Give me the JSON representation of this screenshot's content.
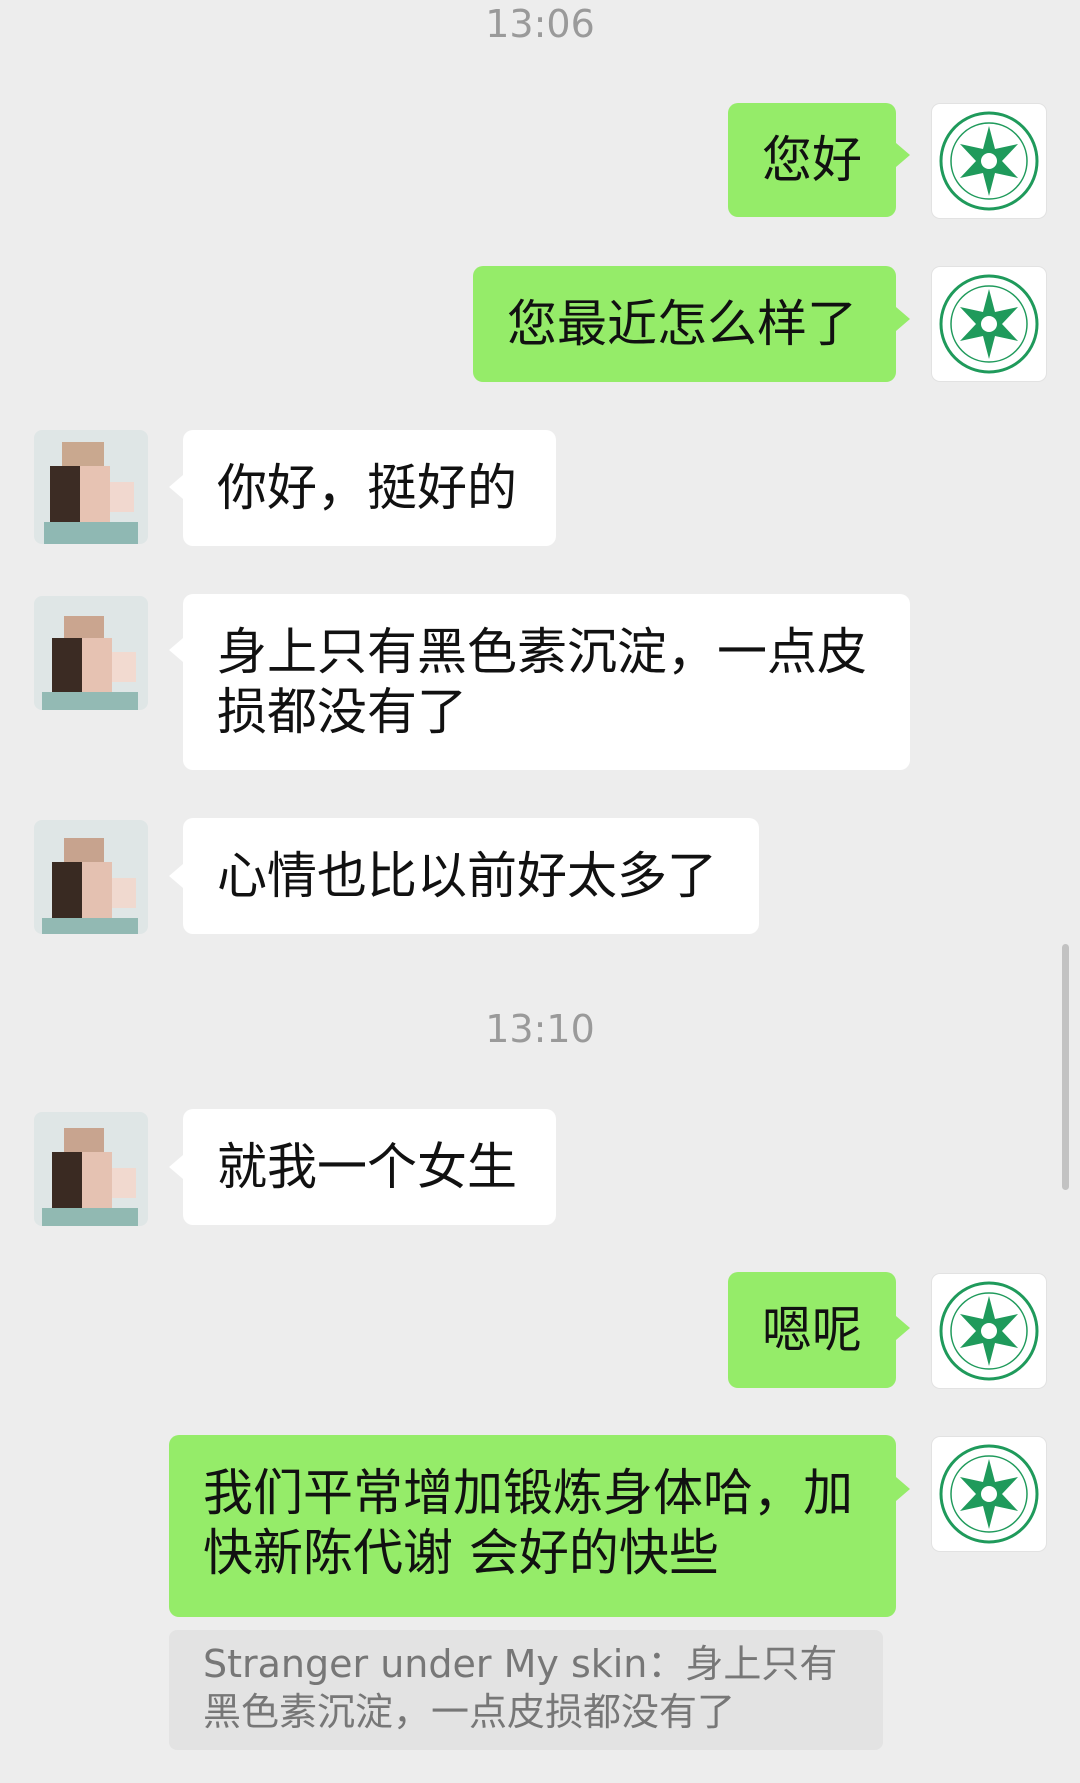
{
  "timestamps": [
    "13:06",
    "13:10"
  ],
  "messages": [
    {
      "side": "out",
      "text": "您好"
    },
    {
      "side": "out",
      "text": "您最近怎么样了"
    },
    {
      "side": "in",
      "text": "你好，挺好的"
    },
    {
      "side": "in",
      "text": "身上只有黑色素沉淀，一点皮\n损都没有了"
    },
    {
      "side": "in",
      "text": "心情也比以前好太多了"
    },
    {
      "side": "in",
      "text": "就我一个女生"
    },
    {
      "side": "out",
      "text": "嗯呢"
    },
    {
      "side": "out",
      "text": "我们平常增加锻炼身体哈，加\n快新陈代谢 会好的快些"
    }
  ],
  "quote": {
    "text": "Stranger under My skin：身上只有\n黑色素沉淀，一点皮损都没有了"
  },
  "colors": {
    "background": "#ededed",
    "outgoing_bubble": "#95ec69",
    "incoming_bubble": "#ffffff",
    "seal_green": "#1f9a5b"
  },
  "icons": {
    "self_avatar": "green-compass-seal-icon",
    "contact_avatar": "pixelated-photo-avatar"
  }
}
